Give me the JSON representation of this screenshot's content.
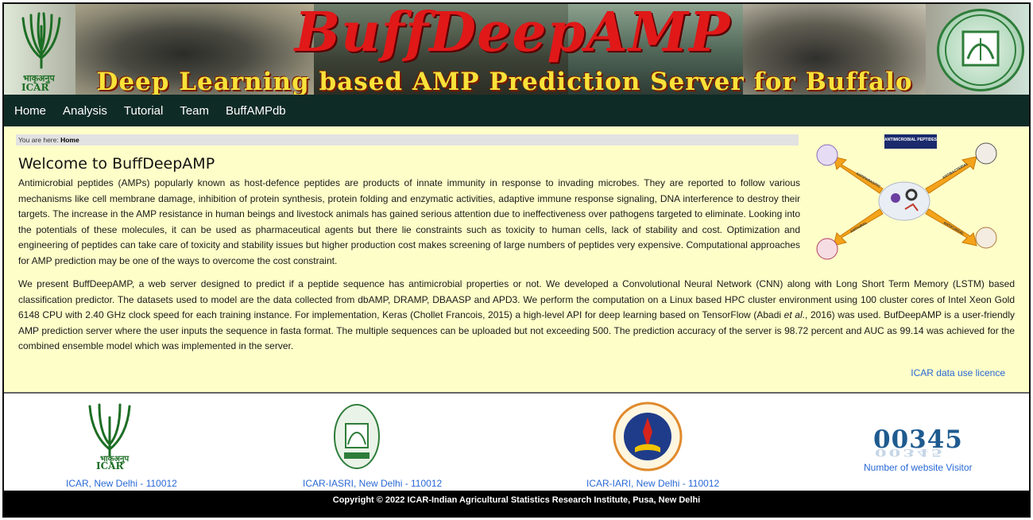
{
  "banner": {
    "title": "BuffDeepAMP",
    "subtitle": "Deep Learning based AMP Prediction Server for Buffalo",
    "logo_left_hindi": "भाकृअनुप",
    "logo_left_text": "ICAR"
  },
  "nav": {
    "items": [
      "Home",
      "Analysis",
      "Tutorial",
      "Team",
      "BuffAMPdb"
    ]
  },
  "breadcrumb": {
    "prefix": "You are here: ",
    "current": "Home"
  },
  "main": {
    "heading": "Welcome to BuffDeepAMP",
    "paragraph1": "Antimicrobial peptides (AMPs) popularly known as host-defence peptides are products of innate immunity in response to invading microbes. They are reported to follow various mechanisms like cell membrane damage, inhibition of protein synthesis, protein folding and enzymatic activities, adaptive immune response signaling, DNA interference to destroy their targets. The increase in the AMP resistance in human beings and livestock animals has gained serious attention due to ineffectiveness over pathogens targeted to eliminate. Looking into the potentials of these molecules, it can be used as pharmaceutical agents but there lie constraints such as toxicity to human cells, lack of stability and cost. Optimization and engineering of peptides can take care of toxicity and stability issues but higher production cost makes screening of large numbers of peptides very expensive. Computational approaches for AMP prediction may be one of the ways to overcome the cost constraint.",
    "paragraph2_a": "We present BuffDeepAMP, a web server designed to predict if a peptide sequence has antimicrobial properties or not. We developed a Convolutional Neural Network (CNN) along with Long Short Term Memory (LSTM) based classification predictor. The datasets used to model are the data collected from dbAMP, DRAMP, DBAASP and APD3. We perform the computation on a Linux based HPC cluster environment using 100 cluster cores of Intel Xeon Gold 6148 CPU with 2.40 GHz clock speed for each training instance. For implementation, Keras (Chollet Francois, 2015) a high-level API for deep learning based on TensorFlow (Abadi ",
    "paragraph2_italic": "et al",
    "paragraph2_b": "., 2016) was used. BufDeepAMP is a user-friendly AMP prediction server where the user inputs the sequence in fasta format. The multiple sequences can be uploaded but not exceeding 500. The prediction accuracy of the server is 98.72 percent and AUC as 99.14 was achieved for the combined ensemble model which was implemented in the server.",
    "licence_link": "ICAR data use licence"
  },
  "amp_diagram": {
    "title": "ANTIMICROBIAL PEPTIDES",
    "labels": [
      "ANTIPARASITIC",
      "ANTIBACTERIAL",
      "ANTIVIRAL",
      "ANTIFUNGAL"
    ]
  },
  "footer": {
    "links": [
      "ICAR, New Delhi - 110012",
      "ICAR-IASRI, New Delhi - 110012",
      "ICAR-IARI, New Delhi - 110012"
    ],
    "icar_hindi": "भाकृअनुप",
    "icar_text": "ICAR",
    "visitor_count": "00345",
    "visitor_label": "Number of website Visitor",
    "copyright": "Copyright © 2022 ICAR-Indian Agricultural Statistics Research Institute, Pusa, New Delhi"
  },
  "colors": {
    "nav_bg": "#0f2b26",
    "content_bg": "#fefec9",
    "link": "#2969d6",
    "title_red": "#e01818",
    "subtitle_yellow": "#f7e23a"
  }
}
